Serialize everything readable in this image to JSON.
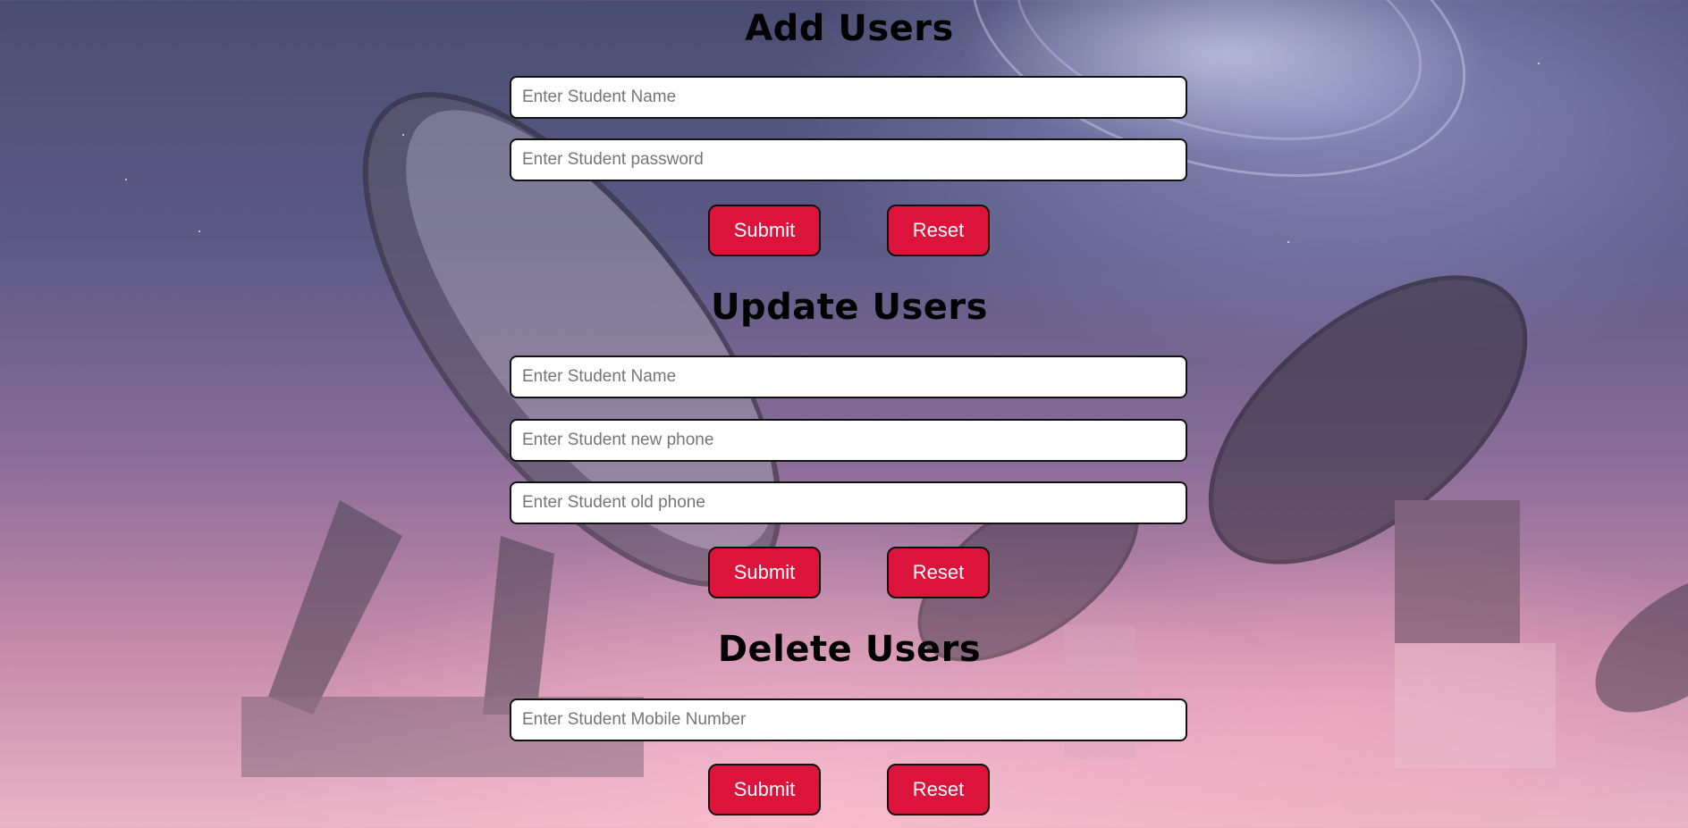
{
  "add_users": {
    "title": "Add Users",
    "name_placeholder": "Enter Student Name",
    "password_placeholder": "Enter Student password",
    "submit_label": "Submit",
    "reset_label": "Reset"
  },
  "update_users": {
    "title": "Update Users",
    "name_placeholder": "Enter Student Name",
    "new_phone_placeholder": "Enter Student new phone",
    "old_phone_placeholder": "Enter Student old phone",
    "submit_label": "Submit",
    "reset_label": "Reset"
  },
  "delete_users": {
    "title": "Delete Users",
    "mobile_placeholder": "Enter Student Mobile Number",
    "submit_label": "Submit",
    "reset_label": "Reset"
  },
  "colors": {
    "button_bg": "#dc143c",
    "button_text": "#ffffff",
    "heading_text": "#000000"
  }
}
